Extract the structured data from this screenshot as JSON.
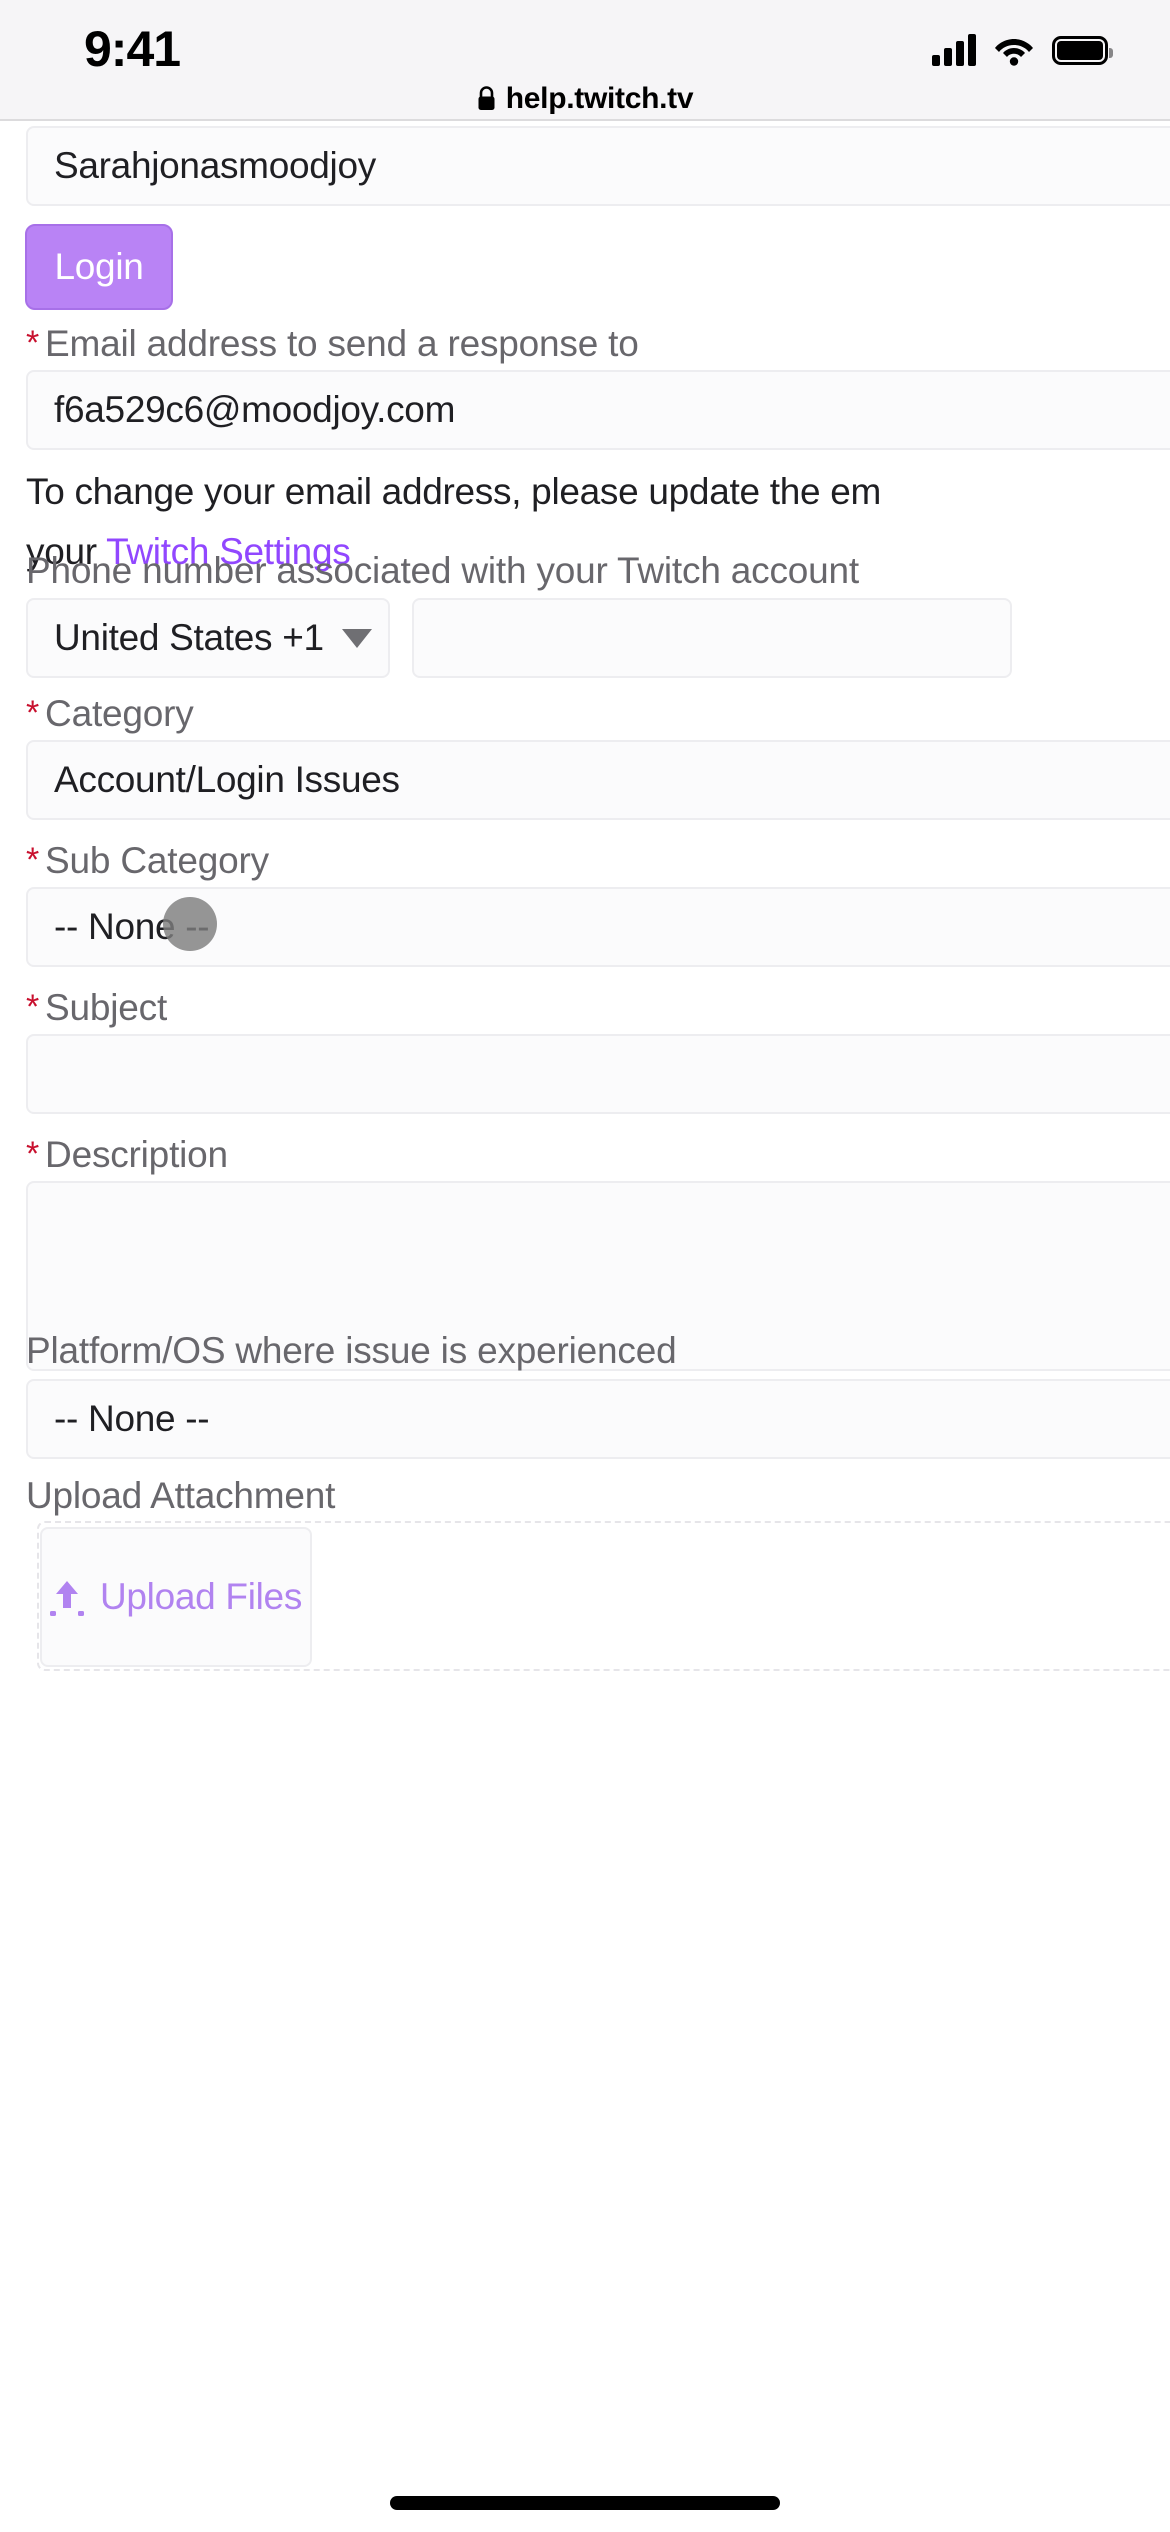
{
  "status_bar": {
    "time": "9:41",
    "signal_icon": "cellular-signal-icon",
    "wifi_icon": "wifi-icon",
    "battery_icon": "battery-full-icon"
  },
  "browser": {
    "lock_icon": "lock-icon",
    "url": "help.twitch.tv"
  },
  "form": {
    "username": {
      "value": "Sarahjonasmoodjoy"
    },
    "login_button": {
      "label": "Login",
      "background": "#b983f5",
      "text_color": "#ffffff"
    },
    "email": {
      "required": true,
      "star": "*",
      "label": "Email address to send a response to",
      "value": "f6a529c6@moodjoy.com",
      "help_line1": "To change your email address, please update the em",
      "help_line2_prefix": "your ",
      "help_link": "Twitch Settings",
      "help_link_color": "#9147ff"
    },
    "phone": {
      "label": "Phone number associated with your Twitch account",
      "country_value": "United States +1",
      "country_caret_icon": "chevron-down-icon",
      "number_value": "",
      "number_placeholder": ""
    },
    "category": {
      "required": true,
      "star": "*",
      "label": "Category",
      "value": "Account/Login Issues"
    },
    "sub_category": {
      "required": true,
      "star": "*",
      "label": "Sub Category",
      "value": "-- None --"
    },
    "subject": {
      "required": true,
      "star": "*",
      "label": "Subject",
      "value": ""
    },
    "description": {
      "required": true,
      "star": "*",
      "label": "Description",
      "value": ""
    },
    "platform": {
      "label": "Platform/OS where issue is experienced",
      "value": "-- None --"
    },
    "upload": {
      "label": "Upload Attachment",
      "button_label": "Upload Files",
      "button_icon": "upload-arrow-icon",
      "button_text_color": "#b183f0"
    }
  },
  "overlay": {
    "touch_indicator": "touch-indicator",
    "home_indicator": "home-indicator"
  }
}
